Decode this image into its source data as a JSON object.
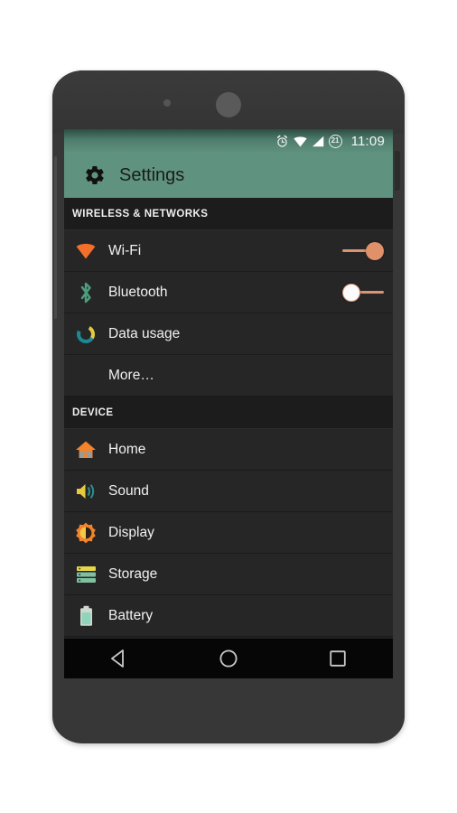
{
  "device": {
    "name": "android-phone-mockup",
    "body_color": "#373737"
  },
  "status_bar": {
    "icons": [
      "alarm-icon",
      "wifi-icon",
      "signal-icon"
    ],
    "battery_level": "21",
    "clock": "11:09",
    "background": "#5f917f"
  },
  "action_bar": {
    "icon": "gear-icon",
    "title": "Settings",
    "background": "#5f9380",
    "title_color": "#1b1b1b"
  },
  "sections": [
    {
      "header": "WIRELESS & NETWORKS",
      "rows": [
        {
          "label": "Wi-Fi",
          "icon": "wifi-icon",
          "control": "toggle",
          "state": "on"
        },
        {
          "label": "Bluetooth",
          "icon": "bluetooth-icon",
          "control": "toggle",
          "state": "off"
        },
        {
          "label": "Data usage",
          "icon": "data-usage-icon",
          "control": "none",
          "state": ""
        },
        {
          "label": "More…",
          "icon": "none",
          "control": "none",
          "state": ""
        }
      ]
    },
    {
      "header": "DEVICE",
      "rows": [
        {
          "label": "Home",
          "icon": "home-icon",
          "control": "none",
          "state": ""
        },
        {
          "label": "Sound",
          "icon": "sound-icon",
          "control": "none",
          "state": ""
        },
        {
          "label": "Display",
          "icon": "display-icon",
          "control": "none",
          "state": ""
        },
        {
          "label": "Storage",
          "icon": "storage-icon",
          "control": "none",
          "state": ""
        },
        {
          "label": "Battery",
          "icon": "battery-icon",
          "control": "none",
          "state": ""
        }
      ]
    }
  ],
  "nav_bar": {
    "buttons": [
      "back-icon",
      "home-icon",
      "recents-icon"
    ],
    "background": "#060606"
  },
  "colors": {
    "accent_salmon": "#e0916a",
    "accent_green": "#5f9380",
    "row_bg": "#262626",
    "section_bg": "#1c1c1c",
    "text": "#f1f1f1"
  }
}
